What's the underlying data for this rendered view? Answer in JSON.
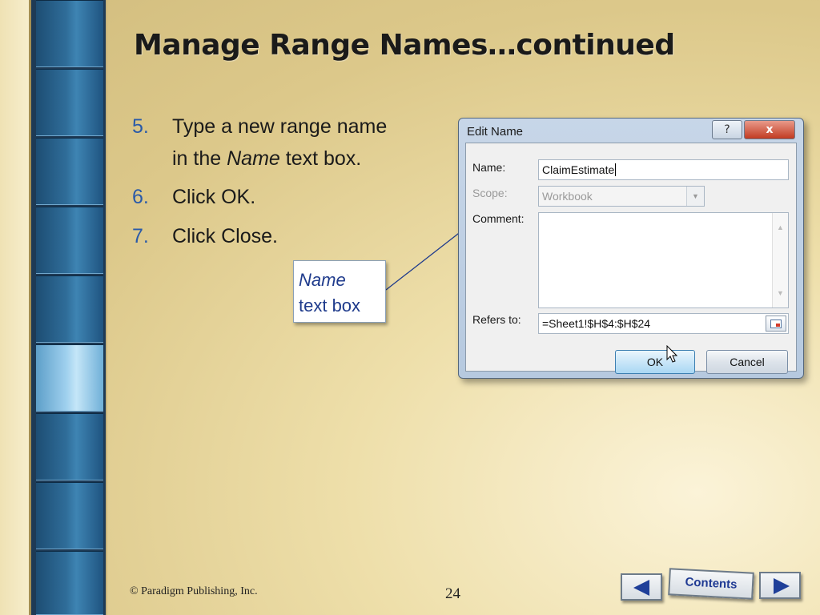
{
  "slide": {
    "title": "Manage Range Names…continued",
    "steps": [
      {
        "num": "5.",
        "line1": "Type a new range name",
        "line2_pre": "in the ",
        "line2_ital": "Name",
        "line2_post": " text box."
      },
      {
        "num": "6.",
        "text": "Click OK."
      },
      {
        "num": "7.",
        "text": "Click Close."
      }
    ],
    "callout": {
      "line1": "Name",
      "line2": "text box"
    },
    "footer": {
      "copyright": "© Paradigm Publishing, Inc.",
      "page": "24"
    },
    "nav": {
      "contents_label": "Contents",
      "prev_icon": "triangle-left-icon",
      "next_icon": "triangle-right-icon"
    }
  },
  "dialog": {
    "title": "Edit Name",
    "help_glyph": "?",
    "close_glyph": "x",
    "name_label": "Name:",
    "name_value": "ClaimEstimate",
    "scope_label": "Scope:",
    "scope_value": "Workbook",
    "comment_label": "Comment:",
    "refers_label": "Refers to:",
    "refers_value": "=Sheet1!$H$4:$H$24",
    "ok_label": "OK",
    "cancel_label": "Cancel"
  },
  "colors": {
    "step_number": "#2a5aa8",
    "callout_text": "#1f3b8c",
    "nav_arrow": "#1f3f99",
    "rail": "#1e3a55"
  }
}
